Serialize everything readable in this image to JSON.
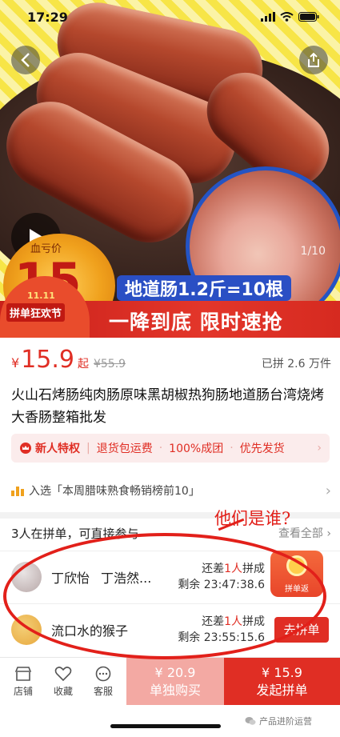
{
  "status_bar": {
    "time": "17:29"
  },
  "hero": {
    "image_counter": "1/10",
    "price_badge_top": "血亏价",
    "price_badge_big": "15",
    "slogan": "地道肠1.2斤=10根",
    "festival_date": "11.11",
    "festival_label": "拼单狂欢节",
    "promo_slogan": "一降到底  限时速抢"
  },
  "product": {
    "currency": "¥",
    "price": "15.9",
    "price_suffix": "起",
    "original_price": "¥55.9",
    "sold_text": "已拼 2.6 万件",
    "title": "火山石烤肠纯肉肠原味黑胡椒热狗肠地道肠台湾烧烤大香肠整箱批发"
  },
  "privilege": {
    "label": "新人特权",
    "items": [
      "退货包运费",
      "100%成团",
      "优先发货"
    ]
  },
  "ranking": {
    "text": "入选「本周腊味熟食畅销榜前10」"
  },
  "group": {
    "header": "3人在拼单，可直接参与",
    "view_all": "查看全部",
    "annotation": "他们是谁?",
    "float_badge_label": "拼单返",
    "rows": [
      {
        "names": [
          "丁欣怡",
          "丁浩然..."
        ],
        "prefix": "还差",
        "count": "1人",
        "suffix": "拼成",
        "remaining": "剩余 23:47:38.6"
      },
      {
        "names": [
          "流口水的猴子"
        ],
        "prefix": "还差",
        "count": "1人",
        "suffix": "拼成",
        "remaining": "剩余 23:55:15.6",
        "button": "去拼单"
      }
    ]
  },
  "bottom_bar": {
    "tabs": [
      "店铺",
      "收藏",
      "客服"
    ],
    "solo_price": "¥ 20.9",
    "solo_label": "单独购买",
    "group_price": "¥ 15.9",
    "group_label": "发起拼单"
  },
  "watermark": "产品进阶运营",
  "colors": {
    "accent": "#e02e24",
    "promo_blue": "#2a4fc4"
  }
}
